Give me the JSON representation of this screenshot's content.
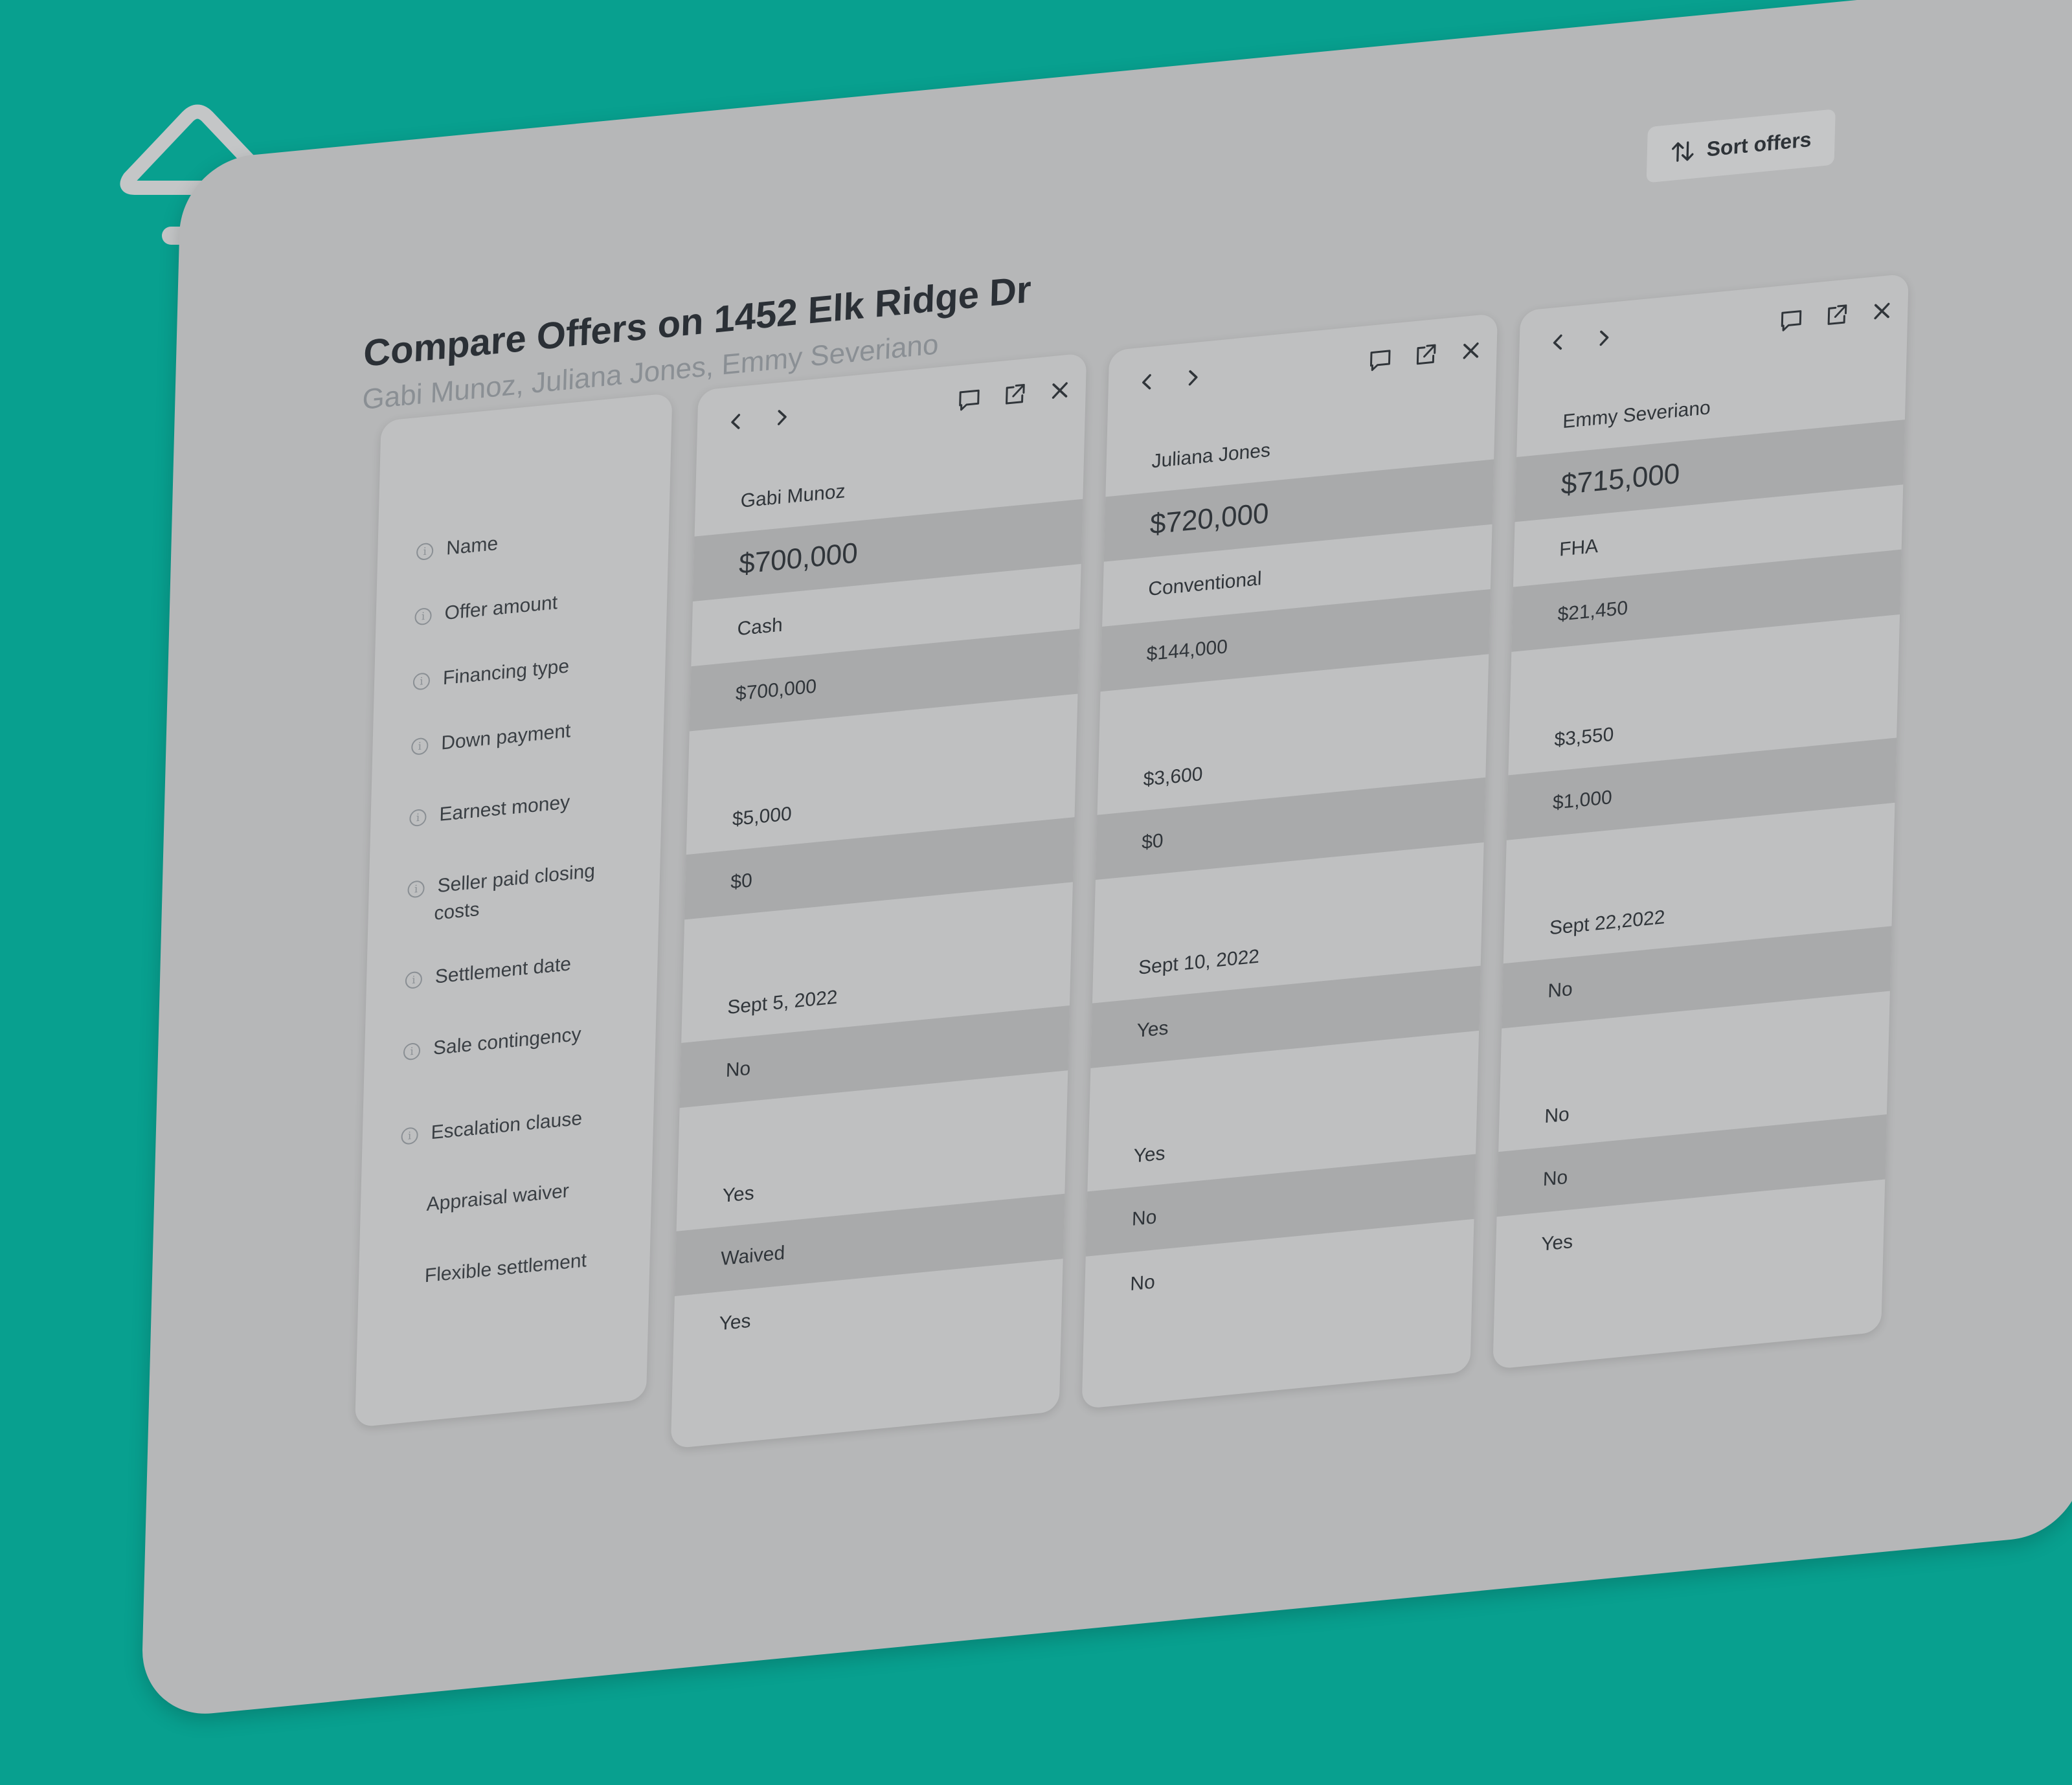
{
  "page": {
    "title": "Compare Offers on 1452 Elk Ridge Dr",
    "subtitle": "Gabi Munoz, Juliana Jones, Emmy Severiano",
    "sort_label": "Sort offers"
  },
  "labels": [
    "Name",
    "Offer amount",
    "Financing type",
    "Down payment",
    "Earnest money",
    "Seller paid closing",
    "costs",
    "Settlement date",
    "Sale contingency",
    "Escalation clause",
    "Appraisal waiver",
    "Flexible settlement"
  ],
  "offers": [
    {
      "name": "Gabi Munoz",
      "offer_amount": "$700,000",
      "financing_type": "Cash",
      "down_payment": "$700,000",
      "earnest_money": "$5,000",
      "seller_paid_closing_costs": "$0",
      "settlement_date": "Sept 5, 2022",
      "sale_contingency": "No",
      "escalation_clause": "Yes",
      "appraisal_waiver": "Waived",
      "flexible_settlement": "Yes"
    },
    {
      "name": "Juliana Jones",
      "offer_amount": "$720,000",
      "financing_type": "Conventional",
      "down_payment": "$144,000",
      "earnest_money": "$3,600",
      "seller_paid_closing_costs": "$0",
      "settlement_date": "Sept 10, 2022",
      "sale_contingency": "Yes",
      "escalation_clause": "Yes",
      "appraisal_waiver": "No",
      "flexible_settlement": "No"
    },
    {
      "name": "Emmy Severiano",
      "offer_amount": "$715,000",
      "financing_type": "FHA",
      "down_payment": "$21,450",
      "earnest_money": "$3,550",
      "seller_paid_closing_costs": "$1,000",
      "settlement_date": "Sept 22,2022",
      "sale_contingency": "No",
      "escalation_clause": "No",
      "appraisal_waiver": "No",
      "flexible_settlement": "Yes"
    }
  ],
  "icons": {
    "logo": "house-logo-icon",
    "sort": "sort-arrows-icon",
    "prev": "chevron-left-icon",
    "next": "chevron-right-icon",
    "comment": "comment-icon",
    "open": "external-link-icon",
    "close": "close-icon"
  },
  "colors": {
    "background": "#08a08f",
    "screen": "#b6b7b8",
    "card": "#bfc0c1",
    "row_shade": "#a9aaab",
    "text": "#2b3036",
    "muted": "#8a8f94"
  }
}
